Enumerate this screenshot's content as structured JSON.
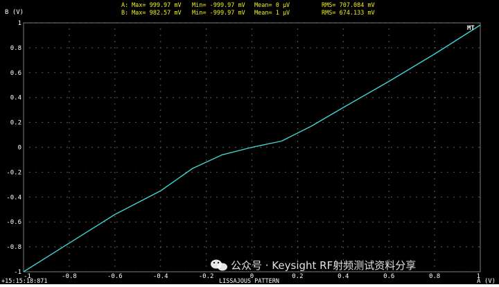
{
  "stats": {
    "channel_a": {
      "label": "A:",
      "max": "Max=  999.97 mV",
      "min": "Min= -999.97 mV",
      "mean": "Mean=        0 µV",
      "rms": "RMS=  707.084 mV"
    },
    "channel_b": {
      "label": "B:",
      "max": "Max=  982.57 mV",
      "min": "Min= -999.97 mV",
      "mean": "Mean=        1 µV",
      "rms": "RMS=  674.133 mV"
    }
  },
  "marker": "MT",
  "footer": {
    "timestamp": "+15:15:18:871",
    "pattern": "LISSAJOUS PATTERN"
  },
  "watermark": "公众号 · Keysight RF射频测试资料分享",
  "colors": {
    "background": "#000000",
    "grid": "#7a7a7a",
    "trace": "#3fd4d4",
    "stats_text": "#f2f21e",
    "axis_text": "#ffffff"
  },
  "chart_data": {
    "type": "line",
    "title": "",
    "xlabel": "A (V)",
    "ylabel": "B (V)",
    "xlim": [
      -1,
      1
    ],
    "ylim": [
      -1,
      1
    ],
    "grid": true,
    "x_ticks": [
      "-1",
      "-0.8",
      "-0.6",
      "-0.4",
      "-0.2",
      "0",
      "0.2",
      "0.4",
      "0.6",
      "0.8",
      "1"
    ],
    "y_ticks": [
      "1",
      "0.8",
      "0.6",
      "0.4",
      "0.2",
      "0",
      "-0.2",
      "-0.4",
      "-0.6",
      "-0.8",
      "-1"
    ],
    "series": [
      {
        "x": [
          -1.0,
          -0.8,
          -0.6,
          -0.4,
          -0.26,
          -0.13,
          0.0,
          0.13,
          0.26,
          0.4,
          0.6,
          0.8,
          1.0
        ],
        "y": [
          -1.0,
          -0.77,
          -0.54,
          -0.35,
          -0.17,
          -0.06,
          0.0,
          0.05,
          0.17,
          0.32,
          0.53,
          0.75,
          0.983
        ]
      }
    ]
  }
}
